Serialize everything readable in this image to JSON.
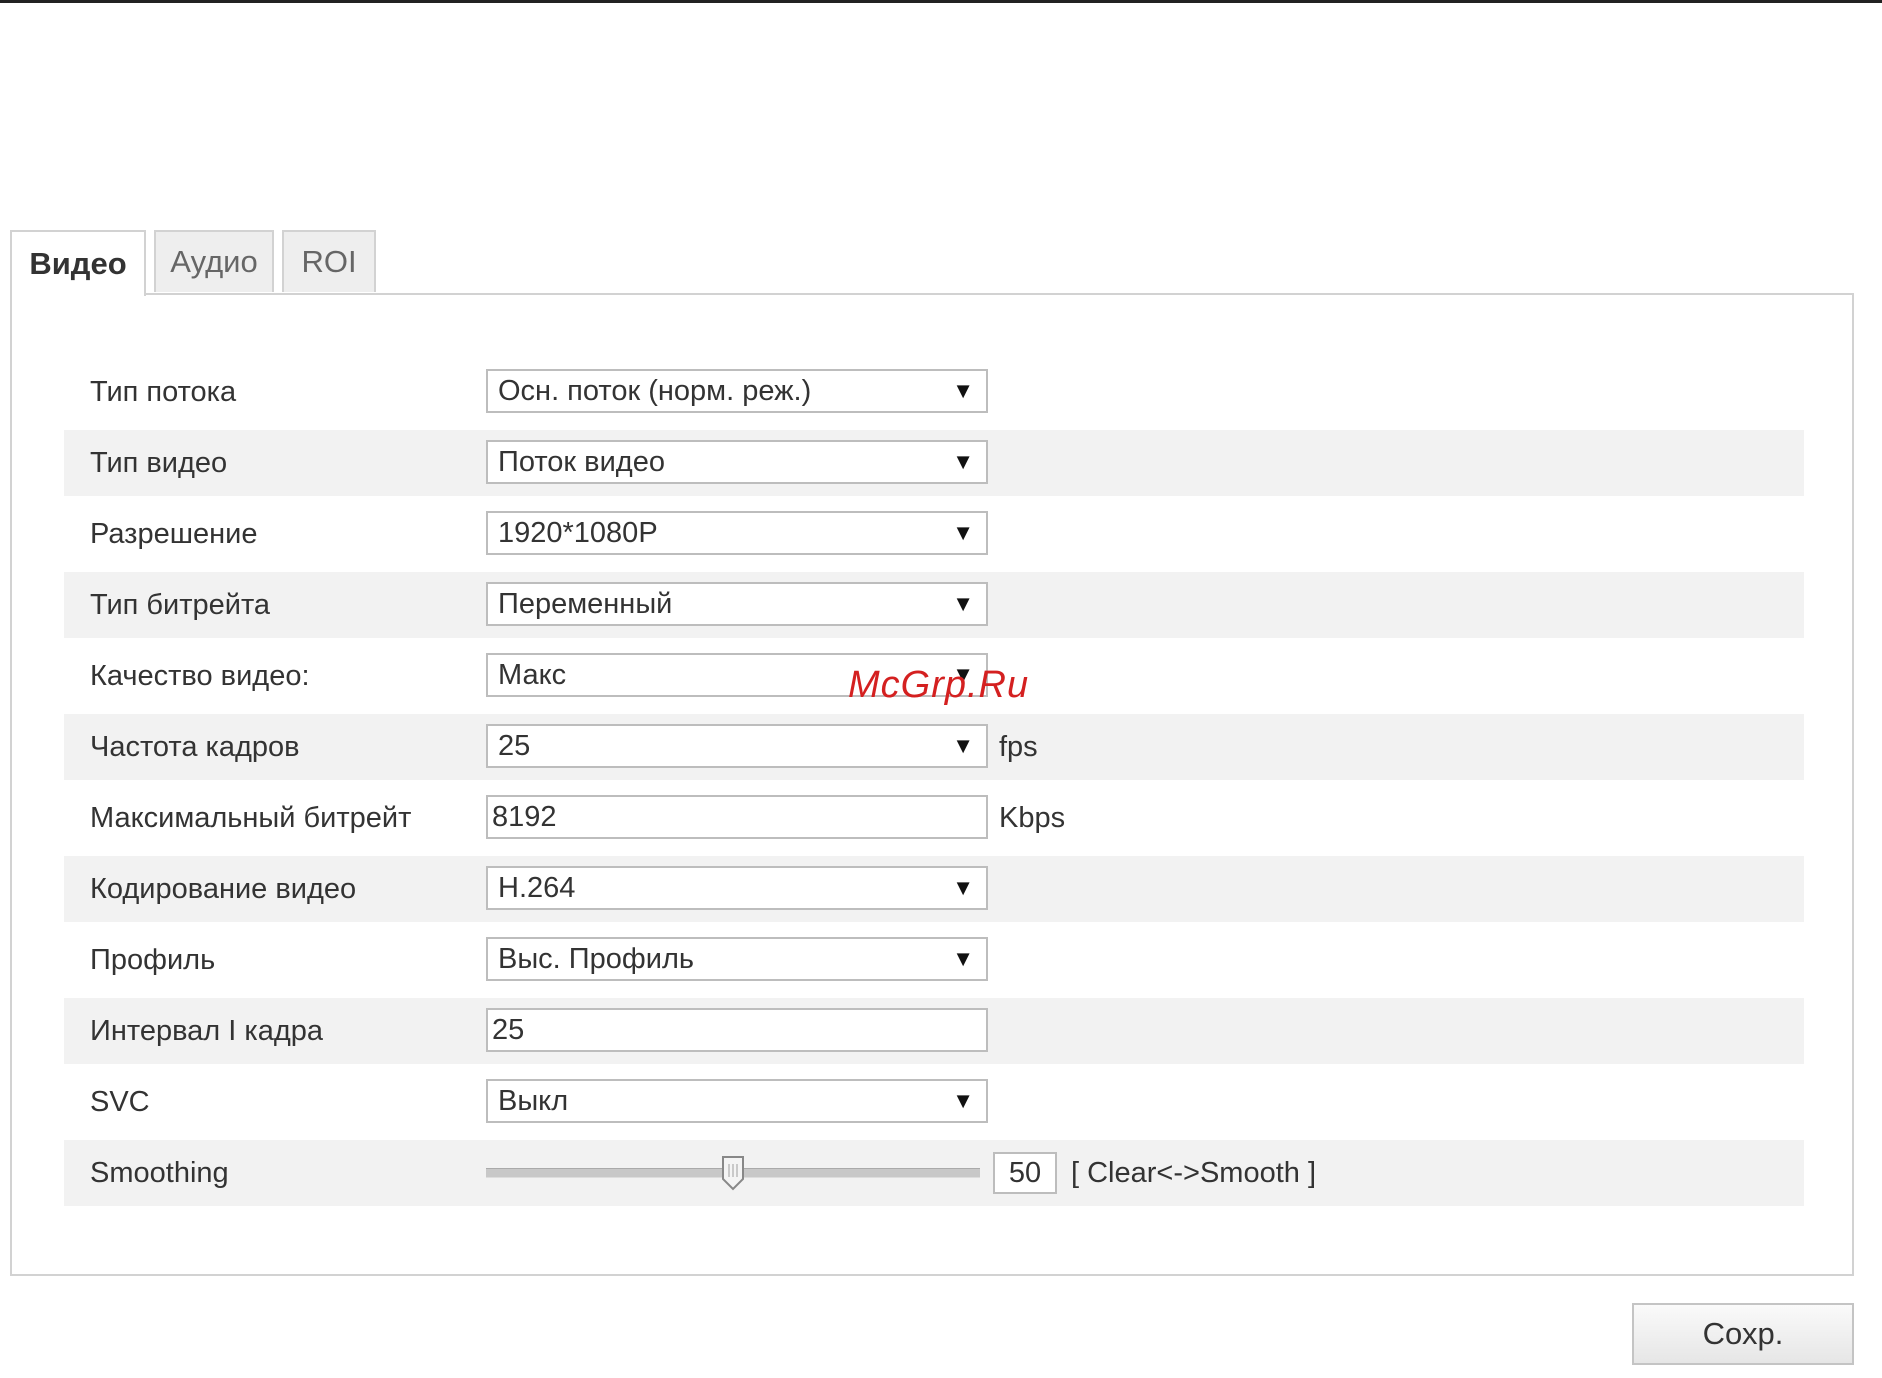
{
  "tabs": [
    {
      "label": "Видео",
      "active": true
    },
    {
      "label": "Аудио",
      "active": false
    },
    {
      "label": "ROI",
      "active": false
    }
  ],
  "rows": [
    {
      "label": "Тип потока",
      "type": "select",
      "value": "Осн. поток (норм. реж.)"
    },
    {
      "label": "Тип видео",
      "type": "select",
      "value": "Поток видео"
    },
    {
      "label": "Разрешение",
      "type": "select",
      "value": "1920*1080P"
    },
    {
      "label": "Тип битрейта",
      "type": "select",
      "value": "Переменный"
    },
    {
      "label": "Качество видео:",
      "type": "select",
      "value": "Макс"
    },
    {
      "label": "Частота кадров",
      "type": "select",
      "value": "25",
      "unit": "fps"
    },
    {
      "label": "Максимальный битрейт",
      "type": "text",
      "value": "8192",
      "unit": "Kbps"
    },
    {
      "label": "Кодирование видео",
      "type": "select",
      "value": "H.264"
    },
    {
      "label": "Профиль",
      "type": "select",
      "value": "Выс. Профиль"
    },
    {
      "label": "Интервал I кадра",
      "type": "text",
      "value": "25"
    },
    {
      "label": "SVC",
      "type": "select",
      "value": "Выкл"
    },
    {
      "label": "Smoothing",
      "type": "slider",
      "value": "50",
      "min": 0,
      "max": 100,
      "hint": "[ Clear<->Smooth ]"
    }
  ],
  "icons": {
    "dropdown": "▼"
  },
  "save_label": "Сохр.",
  "watermark": "McGrp.Ru",
  "colors": {
    "watermark": "#d42020",
    "row_shade": "#f2f2f2",
    "border": "#d2d2d2"
  }
}
